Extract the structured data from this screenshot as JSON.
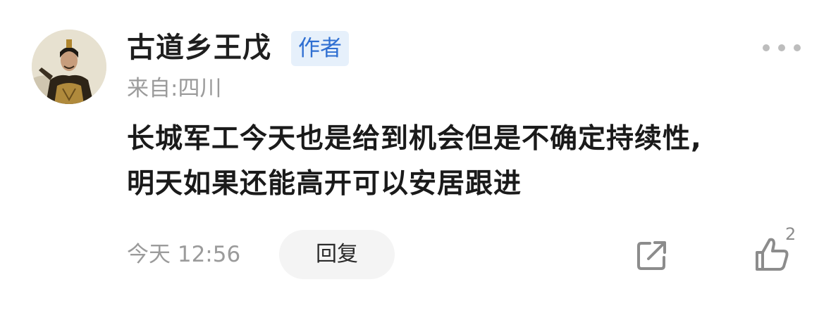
{
  "comment": {
    "username": "古道乡王戊",
    "author_badge": "作者",
    "location": "来自:四川",
    "text_lines": [
      "长城军工今天也是给到机会但是不确定持续性,",
      "明天如果还能高开可以安居跟进"
    ],
    "timestamp": "今天 12:56",
    "reply_label": "回复",
    "like_count": "2",
    "icons": {
      "more": "more-dots-icon",
      "share": "share-icon",
      "like": "thumbs-up-icon"
    }
  },
  "colors": {
    "badge_bg": "#e6f0fb",
    "badge_text": "#2f6fd2",
    "meta_text": "#9b9b9b",
    "reply_bg": "#f4f4f4"
  }
}
